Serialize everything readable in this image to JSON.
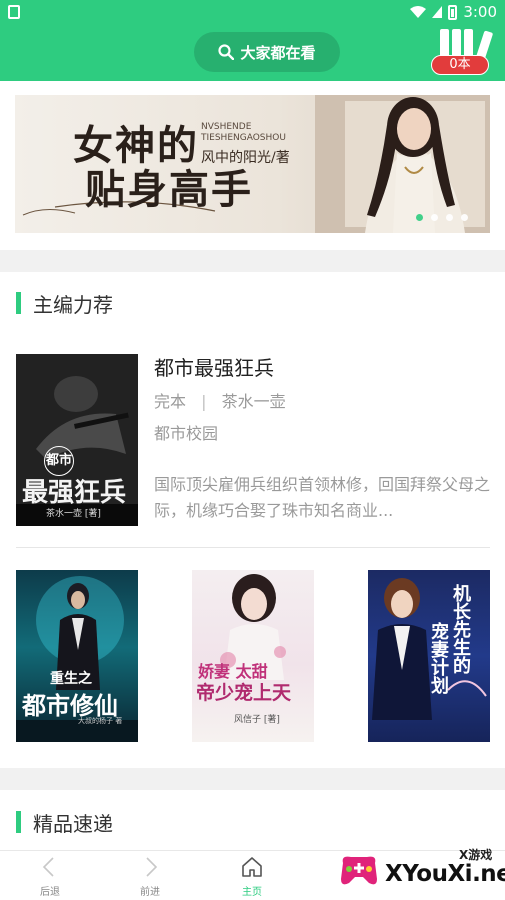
{
  "status_bar": {
    "time": "3:00"
  },
  "header": {
    "search_label": "大家都在看",
    "bookshelf_count": "0本"
  },
  "banner": {
    "title_line1": "女神的",
    "title_line2": "贴身高手",
    "pinyin_line1": "NVSHENDE",
    "pinyin_line2": "TIESHENGAOSHOU",
    "author": "风中的阳光/著",
    "page_count": 4,
    "active_page": 0
  },
  "sections": {
    "recommend": {
      "title": "主编力荐"
    },
    "express": {
      "title": "精品速递"
    }
  },
  "featured_book": {
    "title": "都市最强狂兵",
    "status": "完本",
    "separator": "|",
    "author": "茶水一壶",
    "category": "都市校园",
    "description": "国际顶尖雇佣兵组织首领林修，回国拜祭父母之际，机缘巧合娶了珠市知名商业...",
    "cover_title_small": "都市",
    "cover_title": "最强狂兵",
    "cover_author": "茶水一壶 [著]"
  },
  "book_row": [
    {
      "cover_title_line1": "重生之",
      "cover_title_line2": "都市修仙",
      "cover_author": "大叔的杨子 著"
    },
    {
      "cover_title_line1": "娇妻 太甜",
      "cover_title_line2": "帝少宠上天",
      "cover_author": "风信子 [著]"
    },
    {
      "cover_title_line1": "机长先生的",
      "cover_title_line2": "宠妻计划",
      "cover_author": ""
    }
  ],
  "bottom_nav": [
    {
      "label": "后退",
      "icon": "chevron-left-icon",
      "active": false
    },
    {
      "label": "前进",
      "icon": "chevron-right-icon",
      "active": false
    },
    {
      "label": "主页",
      "icon": "home-icon",
      "active": true
    }
  ],
  "watermark": {
    "top": "X游戏",
    "main": "XYouXi.net"
  },
  "colors": {
    "primary": "#2ecc80",
    "badge": "#e23c3c",
    "text_main": "#333333",
    "text_muted": "#9a9a9a"
  }
}
